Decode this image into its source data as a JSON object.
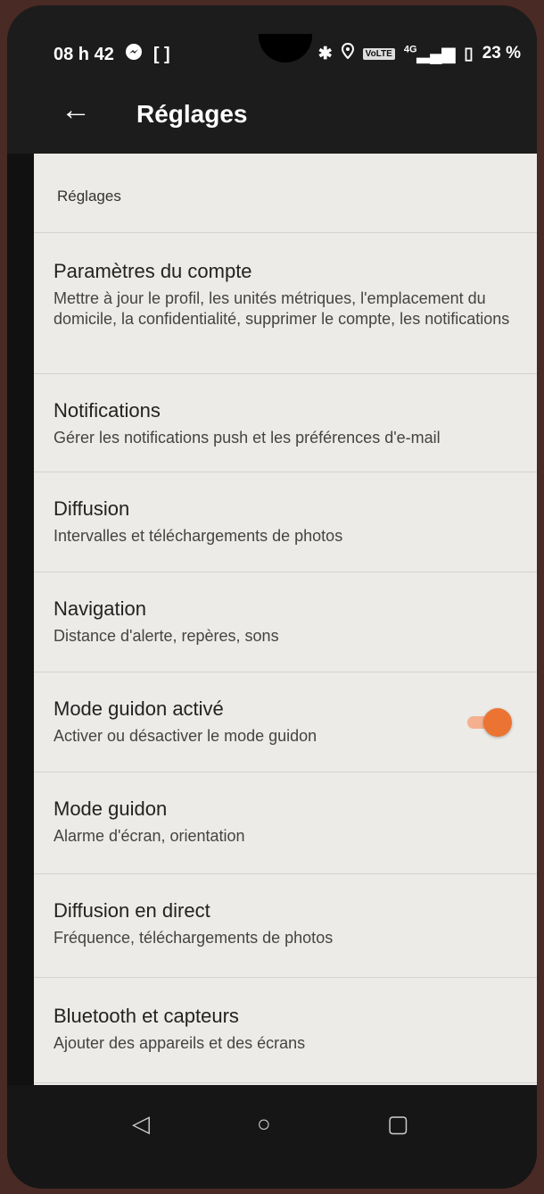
{
  "status_bar": {
    "time": "08 h 42",
    "left_icons": [
      "messenger-icon",
      "bracket-icon"
    ],
    "right_icons": [
      "bluetooth-icon",
      "location-icon",
      "volte-icon",
      "signal-4g-icon",
      "battery-icon"
    ],
    "volte_label": "VoLTE",
    "network": "4G",
    "battery": "23 %"
  },
  "app_bar": {
    "title": "Réglages"
  },
  "section": {
    "header": "Réglages"
  },
  "settings": [
    {
      "title": "Paramètres du compte",
      "subtitle": "Mettre à jour le profil, les unités métriques, l'emplacement du domicile, la confidentialité, supprimer le compte, les notifications"
    },
    {
      "title": "Notifications",
      "subtitle": "Gérer les notifications push et les préférences d'e-mail"
    },
    {
      "title": "Diffusion",
      "subtitle": "Intervalles et téléchargements de photos"
    },
    {
      "title": "Navigation",
      "subtitle": "Distance d'alerte, repères, sons"
    },
    {
      "title": "Mode guidon activé",
      "subtitle": "Activer ou désactiver le mode guidon",
      "toggle": true
    },
    {
      "title": "Mode guidon",
      "subtitle": "Alarme d'écran, orientation"
    },
    {
      "title": "Diffusion en direct",
      "subtitle": "Fréquence, téléchargements de photos"
    },
    {
      "title": "Bluetooth et capteurs",
      "subtitle": "Ajouter des appareils et des écrans"
    }
  ],
  "colors": {
    "accent": "#ec7433",
    "appbar": "#1c1c1c",
    "background": "#ecebe7"
  }
}
